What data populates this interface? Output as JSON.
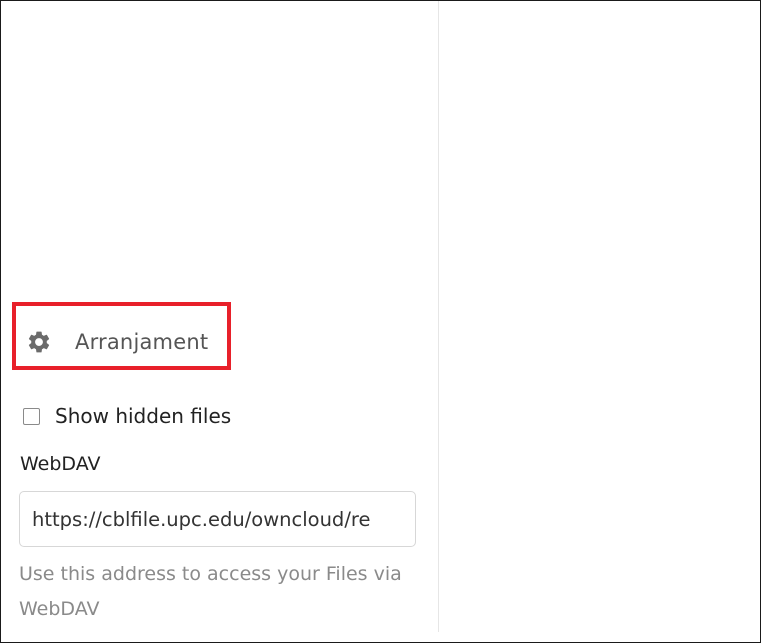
{
  "settings": {
    "label": "Arranjament",
    "icon": "gear-icon",
    "highlight_color": "#e8202a"
  },
  "hidden_files": {
    "label": "Show hidden files",
    "checked": false
  },
  "webdav": {
    "title": "WebDAV",
    "url": "https://cblfile.upc.edu/owncloud/re",
    "help": "Use this address to access your Files via WebDAV"
  }
}
